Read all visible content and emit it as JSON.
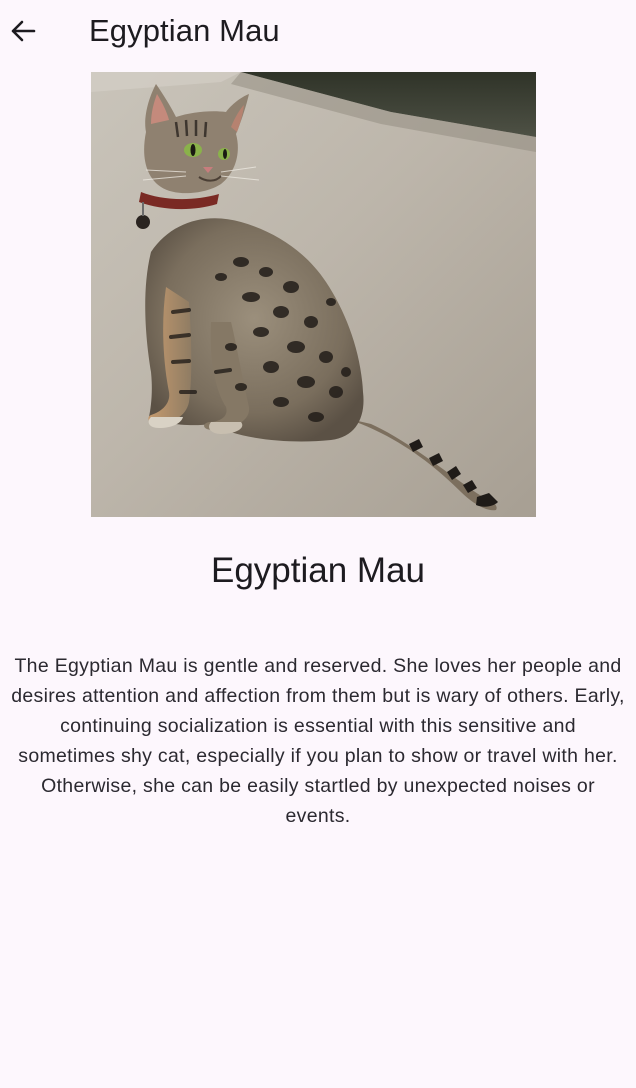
{
  "app_bar": {
    "back_icon": "arrow-back-icon",
    "title": "Egyptian Mau"
  },
  "breed": {
    "name": "Egyptian Mau",
    "description": "The Egyptian Mau is gentle and reserved. She loves her people and desires attention and affection from them but is wary of others. Early, continuing socialization is essential with this sensitive and sometimes shy cat, especially if you plan to show or travel with her. Otherwise, she can be easily startled by unexpected noises or events."
  }
}
